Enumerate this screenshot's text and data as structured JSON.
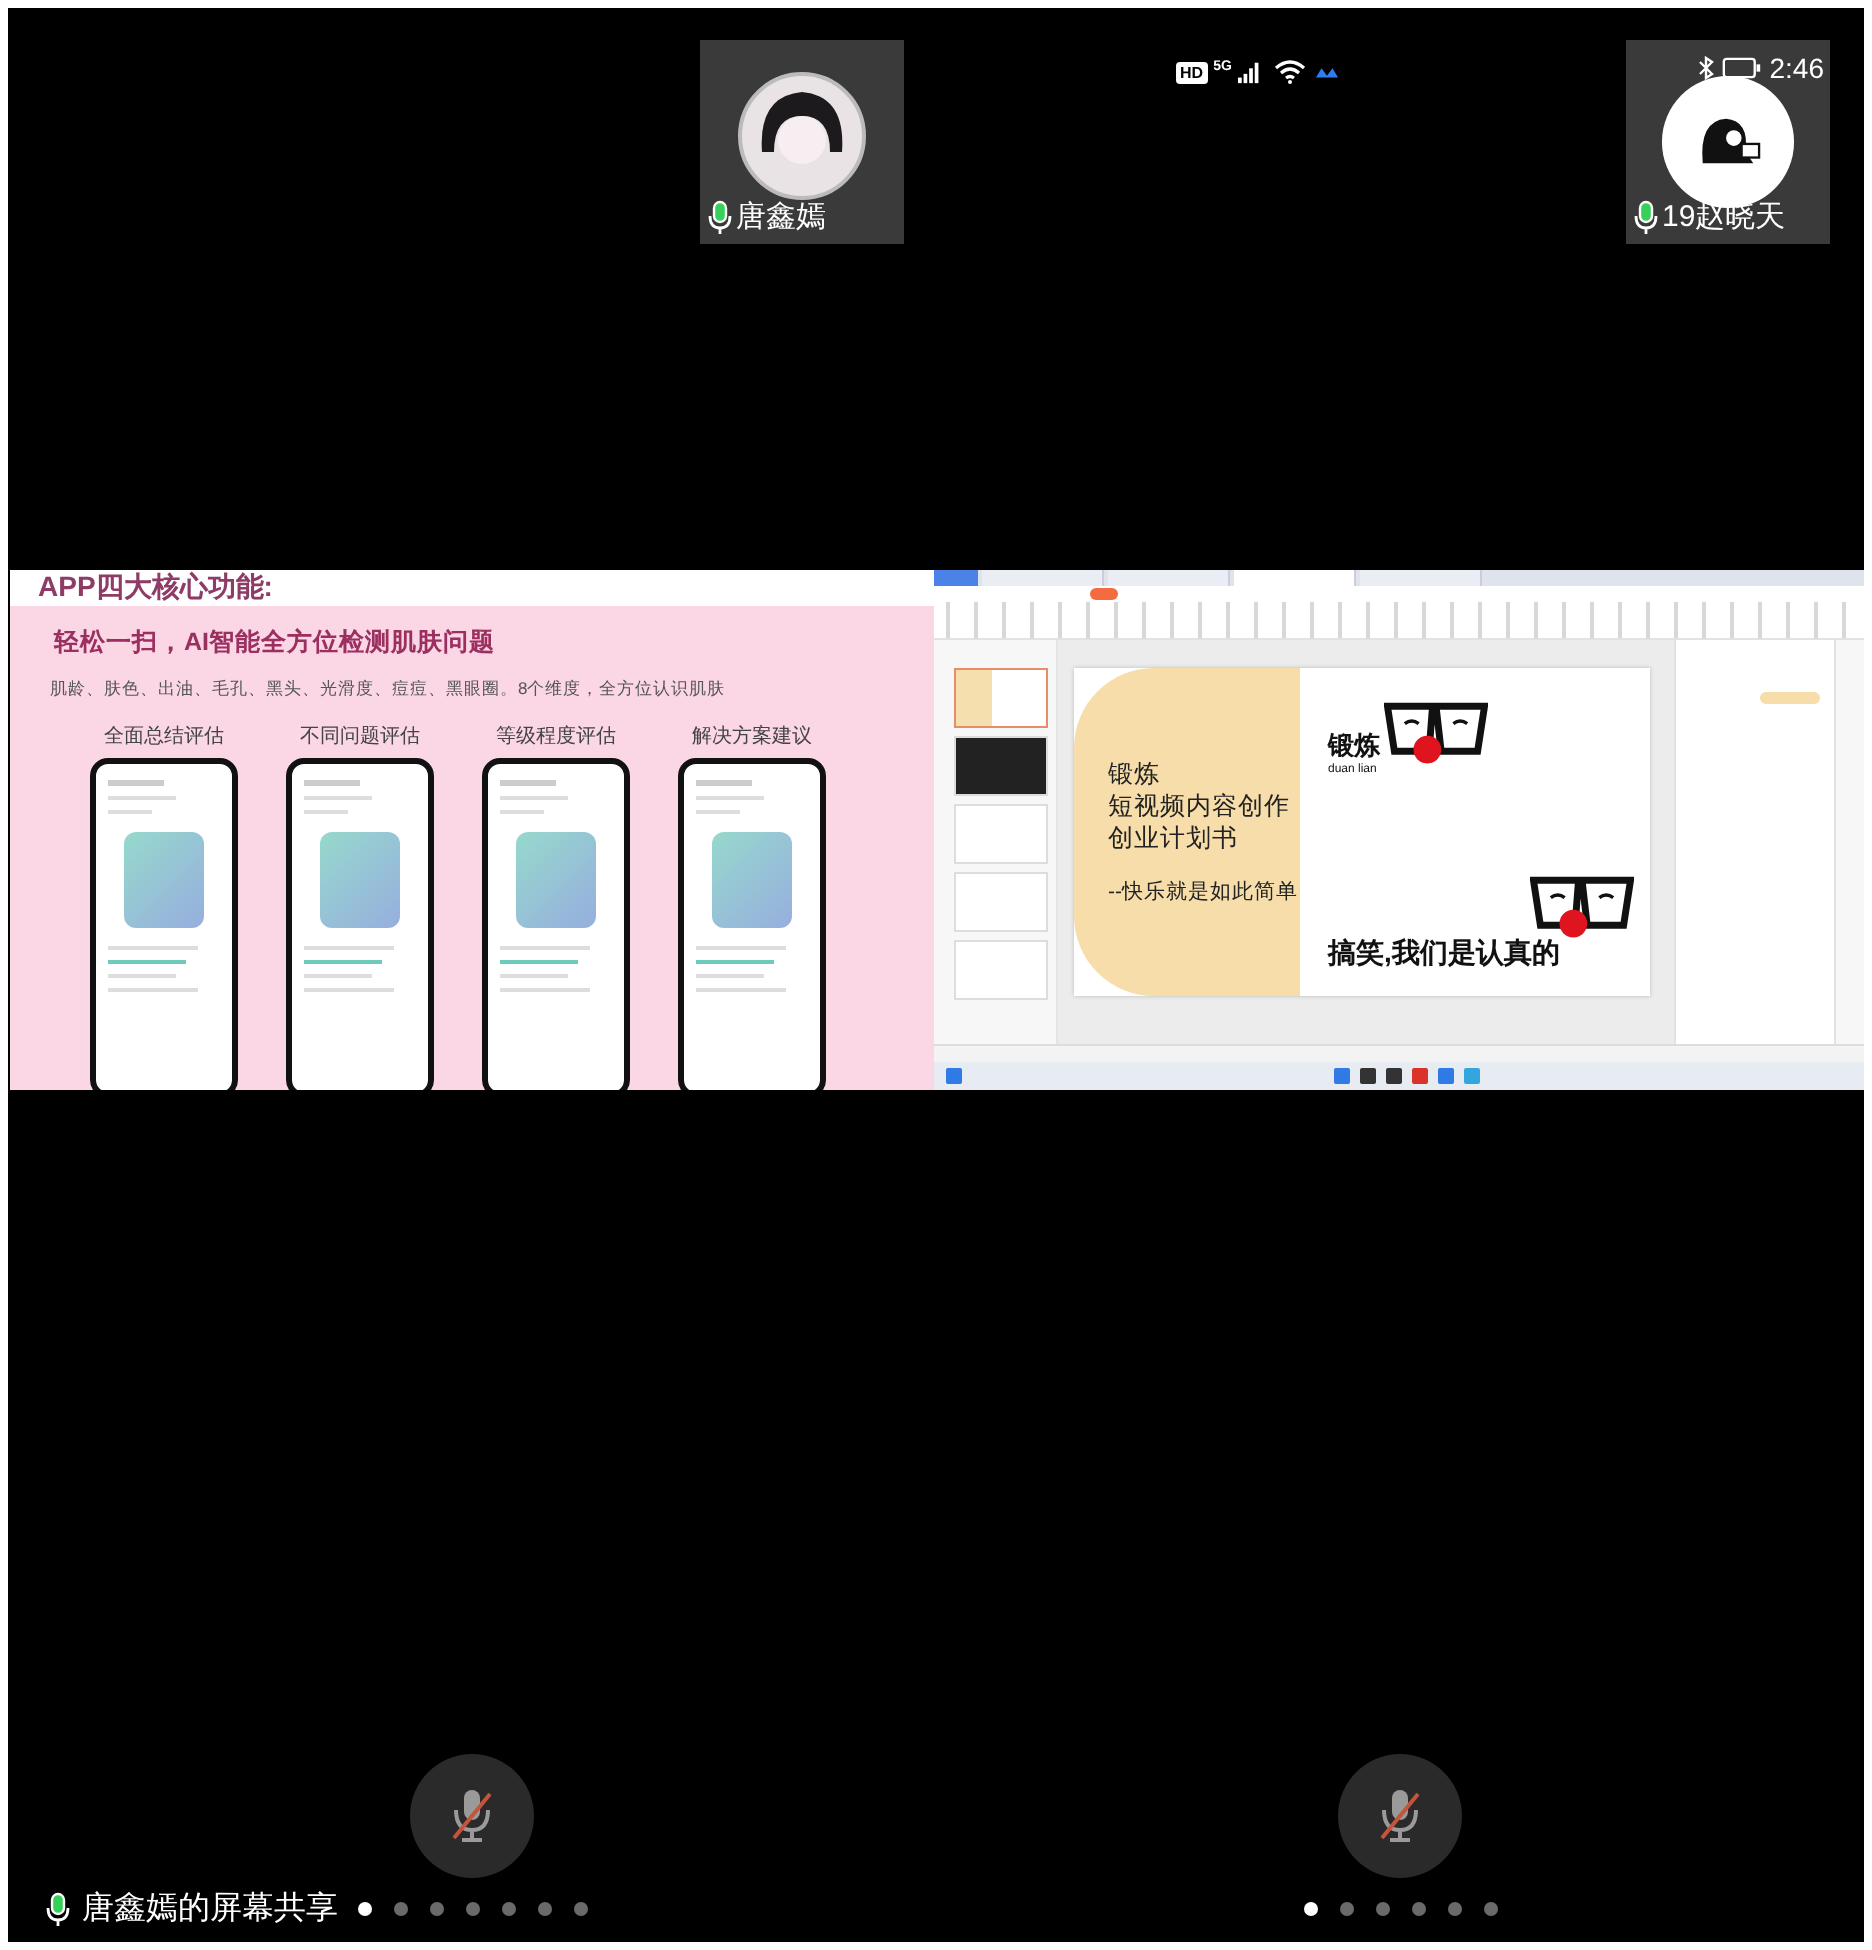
{
  "status_bar": {
    "hd": "HD",
    "network": "5G",
    "time": "2:46"
  },
  "participants": [
    {
      "name": "唐鑫嫣",
      "speaking": true
    },
    {
      "name": "19赵晓天",
      "speaking": true
    }
  ],
  "left_share": {
    "header": "APP四大核心功能:",
    "headline": "轻松一扫，AI智能全方位检测肌肤问题",
    "description": "肌龄、肤色、出油、毛孔、黑头、光滑度、痘痘、黑眼圈。8个维度，全方位认识肌肤",
    "features": [
      {
        "label": "全面总结评估"
      },
      {
        "label": "不同问题评估"
      },
      {
        "label": "等级程度评估"
      },
      {
        "label": "解决方案建议"
      }
    ]
  },
  "right_share": {
    "slide_title_lines": [
      "锻炼",
      "短视频内容创作",
      "创业计划书"
    ],
    "slide_subtitle": "--快乐就是如此简单",
    "logo_text": "锻炼",
    "logo_subtext": "duan lian",
    "slogan": "搞笑,我们是认真的"
  },
  "bottom": [
    {
      "caption": "唐鑫嫣的屏幕共享",
      "muted": true,
      "pages": [
        {
          "selected": true
        },
        {
          "selected": false
        },
        {
          "selected": false
        },
        {
          "selected": false
        },
        {
          "selected": false
        },
        {
          "selected": false
        },
        {
          "selected": false
        }
      ]
    },
    {
      "muted": true,
      "pages": [
        {
          "selected": true
        },
        {
          "selected": false
        },
        {
          "selected": false
        },
        {
          "selected": false
        },
        {
          "selected": false
        },
        {
          "selected": false
        }
      ]
    }
  ]
}
